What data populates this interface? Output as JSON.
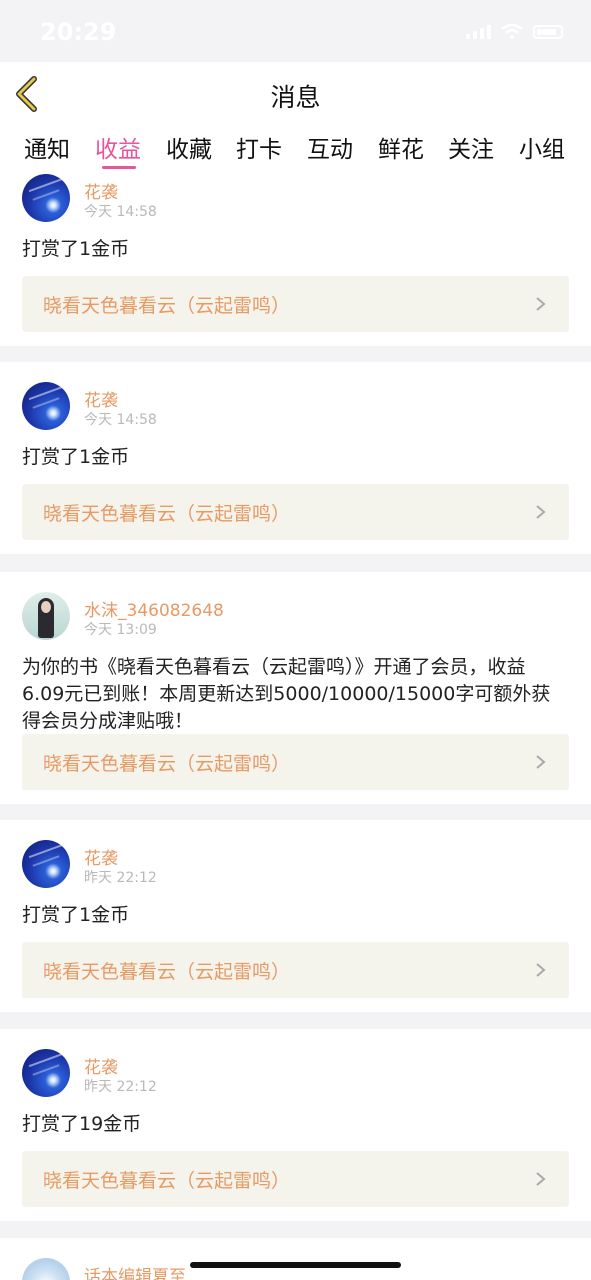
{
  "status_bar": {
    "time": "20:29"
  },
  "header": {
    "title": "消息"
  },
  "tabs": [
    "通知",
    "收益",
    "收藏",
    "打卡",
    "互动",
    "鲜花",
    "关注",
    "小组"
  ],
  "active_tab": "收益",
  "colors": {
    "accent_pink": "#e8559a",
    "name_orange": "#e89a64",
    "link_bg": "#f4f4ec",
    "page_bg": "#f3f2f5"
  },
  "items": [
    {
      "user": "花袭",
      "time": "今天 14:58",
      "message": "打赏了1金币",
      "book": "晓看天色暮看云（云起雷鸣）",
      "avatar": "blue-abstract"
    },
    {
      "user": "花袭",
      "time": "今天 14:58",
      "message": "打赏了1金币",
      "book": "晓看天色暮看云（云起雷鸣）",
      "avatar": "blue-abstract"
    },
    {
      "user": "水沫_346082648",
      "time": "今天 13:09",
      "message": "为你的书《晓看天色暮看云（云起雷鸣）》开通了会员，收益6.09元已到账！本周更新达到5000/10000/15000字可额外获得会员分成津贴哦！",
      "book": "晓看天色暮看云（云起雷鸣）",
      "avatar": "girl-photo"
    },
    {
      "user": "花袭",
      "time": "昨天 22:12",
      "message": "打赏了1金币",
      "book": "晓看天色暮看云（云起雷鸣）",
      "avatar": "blue-abstract"
    },
    {
      "user": "花袭",
      "time": "昨天 22:12",
      "message": "打赏了19金币",
      "book": "晓看天色暮看云（云起雷鸣）",
      "avatar": "blue-abstract"
    },
    {
      "user": "话本编辑夏至",
      "avatar": "pale-blue"
    }
  ]
}
